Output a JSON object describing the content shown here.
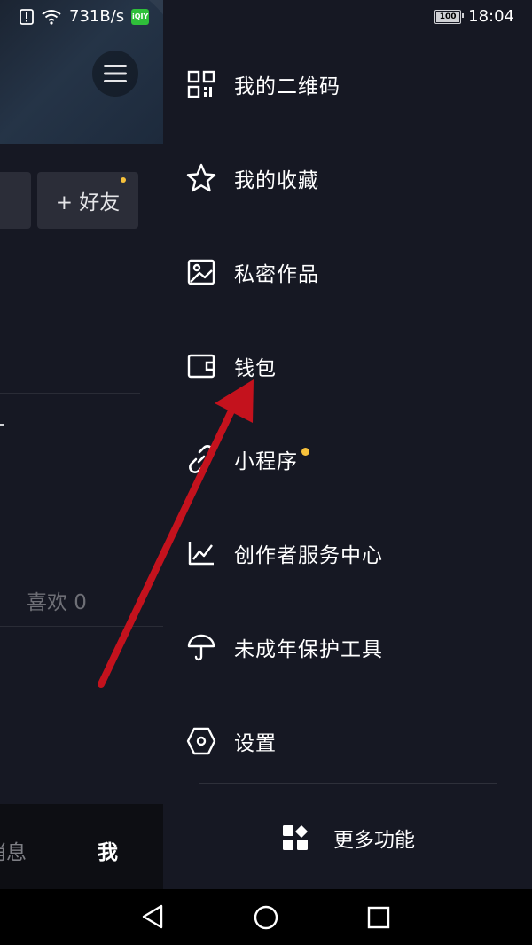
{
  "status_bar": {
    "network_speed": "731B/s",
    "app_badge": "iQIY",
    "battery": "100",
    "time": "18:04"
  },
  "left_pane": {
    "add_friend": "+ 好友",
    "likes": "喜欢 0",
    "tab_messages": "消息",
    "tab_me": "我"
  },
  "drawer": {
    "items": [
      {
        "label": "我的二维码",
        "icon": "qr-code-icon"
      },
      {
        "label": "我的收藏",
        "icon": "star-icon"
      },
      {
        "label": "私密作品",
        "icon": "image-icon"
      },
      {
        "label": "钱包",
        "icon": "wallet-icon"
      },
      {
        "label": "小程序",
        "icon": "link-icon",
        "badge": true
      },
      {
        "label": "创作者服务中心",
        "icon": "chart-line-icon"
      },
      {
        "label": "未成年保护工具",
        "icon": "umbrella-icon"
      },
      {
        "label": "设置",
        "icon": "hexagon-settings-icon"
      }
    ],
    "more_functions": "更多功能"
  },
  "colors": {
    "background": "#161823",
    "accent_dot": "#f7c13b",
    "annotation_arrow": "#c4121d"
  }
}
